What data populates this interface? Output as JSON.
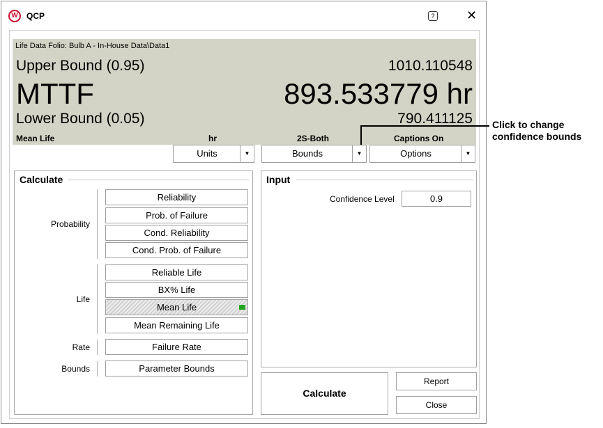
{
  "window": {
    "title": "QCP",
    "help_icon": "help-icon",
    "close_icon": "close-icon",
    "help_glyph": "?",
    "close_glyph": "✕"
  },
  "results": {
    "folio": "Life Data Folio: Bulb A - In-House Data\\Data1",
    "upper_bound_label": "Upper Bound (0.95)",
    "upper_bound_value": "1010.110548",
    "main_label": "MTTF",
    "main_value": "893.533779 hr",
    "lower_bound_label": "Lower Bound (0.05)",
    "lower_bound_value": "790.411125",
    "caption_mean": "Mean Life",
    "caption_units": "hr",
    "caption_bounds": "2S-Both",
    "caption_options": "Captions On"
  },
  "dropdowns": {
    "units": "Units",
    "bounds": "Bounds",
    "options": "Options",
    "arrow_glyph": "▼"
  },
  "calculate": {
    "title": "Calculate",
    "categories": {
      "probability": "Probability",
      "life": "Life",
      "rate": "Rate",
      "bounds": "Bounds"
    },
    "buttons": {
      "reliability": "Reliability",
      "prob_failure": "Prob. of Failure",
      "cond_reliability": "Cond. Reliability",
      "cond_prob_failure": "Cond. Prob. of Failure",
      "reliable_life": "Reliable Life",
      "bx_life": "BX% Life",
      "mean_life": "Mean Life",
      "mean_remaining_life": "Mean Remaining Life",
      "failure_rate": "Failure Rate",
      "parameter_bounds": "Parameter Bounds"
    },
    "selected": "Mean Life",
    "selected_indicator_color": "#1ea51e"
  },
  "input": {
    "title": "Input",
    "confidence_label": "Confidence Level",
    "confidence_value": "0.9"
  },
  "actions": {
    "calculate": "Calculate",
    "report": "Report",
    "close": "Close"
  },
  "callout": {
    "line1": "Click to change",
    "line2": "confidence bounds"
  },
  "colors": {
    "results_background": "#d4d4c6",
    "brand": "#c8102e"
  }
}
